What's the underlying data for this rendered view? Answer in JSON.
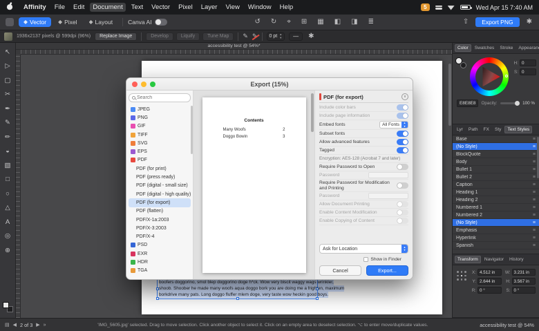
{
  "icons": {
    "arrow_up": "▲",
    "arrow_down": "▼",
    "menu_handle": "≡",
    "chevron_down": "∨",
    "prev": "◀",
    "next": "▶",
    "last": "»",
    "pages": "▤",
    "line": "—",
    "gear": "✱",
    "share": "⇧",
    "paint": "✎"
  },
  "menubar": {
    "items": [
      {
        "label": "Affinity",
        "cls": "b"
      },
      {
        "label": "File"
      },
      {
        "label": "Edit"
      },
      {
        "label": "Document",
        "cls": "hl"
      },
      {
        "label": "Text"
      },
      {
        "label": "Vector"
      },
      {
        "label": "Pixel"
      },
      {
        "label": "Layer"
      },
      {
        "label": "View"
      },
      {
        "label": "Window"
      },
      {
        "label": "Help"
      }
    ],
    "status": {
      "badge": "5",
      "time": "Wed Apr 15 7:40 AM"
    }
  },
  "toolbar": {
    "personas": [
      {
        "label": "Vector",
        "cls": "sel"
      },
      {
        "label": "Pixel"
      },
      {
        "label": "Layout"
      }
    ],
    "canva_label": "Canva AI",
    "center_icons": [
      {
        "name": "undo-icon",
        "glyph": "↺"
      },
      {
        "name": "redo-icon",
        "glyph": "↻"
      },
      {
        "name": "snapping-icon",
        "glyph": "⌖"
      },
      {
        "name": "grid-icon",
        "glyph": "⊞"
      },
      {
        "name": "guides-icon",
        "glyph": "▦"
      },
      {
        "name": "insert-inside-icon",
        "glyph": "◧"
      },
      {
        "name": "insert-behind-icon",
        "glyph": "◨"
      },
      {
        "name": "order-icon",
        "glyph": "≣"
      }
    ],
    "export_button": "Export PNG"
  },
  "context_bar": {
    "image_info": "1936x2137 pixels @ 599dpi (96%)",
    "replace_label": "Replace Image",
    "buttons": [
      {
        "label": "Develop"
      },
      {
        "label": "Liquify"
      },
      {
        "label": "Tune Map"
      }
    ],
    "stroke_width": "0 pt"
  },
  "tools": [
    {
      "name": "move-tool-icon",
      "glyph": "↖"
    },
    {
      "name": "node-tool-icon",
      "glyph": "▷"
    },
    {
      "name": "frame-tool-icon",
      "glyph": "▢"
    },
    {
      "name": "crop-tool-icon",
      "glyph": "✂"
    },
    {
      "name": "pen-tool-icon",
      "glyph": "✒"
    },
    {
      "name": "pencil-tool-icon",
      "glyph": "✎"
    },
    {
      "name": "brush-tool-icon",
      "glyph": "✏"
    },
    {
      "name": "fill-tool-icon",
      "glyph": "◒"
    },
    {
      "name": "transparency-tool-icon",
      "glyph": "▧"
    },
    {
      "name": "rectangle-tool-icon",
      "glyph": "□"
    },
    {
      "name": "ellipse-tool-icon",
      "glyph": "○"
    },
    {
      "name": "shape-tool-icon",
      "glyph": "△"
    },
    {
      "name": "text-tool-icon",
      "glyph": "A"
    },
    {
      "name": "color-picker-tool-icon",
      "glyph": "◎"
    },
    {
      "name": "zoom-tool-icon",
      "glyph": "⊕"
    }
  ],
  "canvas": {
    "doc_tab": "accessibility test @ 54%*",
    "text_lines": [
      "boofers doggorino, smol blep doggorino doge h*ck. Wow very biscit waggy wags wrinkler,",
      "shoob. Shoober he made many woofs aqua doggo bork you are doing me a frighten, maximum",
      "borkdrive many pats. Long doggo fluffer mlem doge, very taste wow heckin good boys."
    ]
  },
  "export_dialog": {
    "title": "Export (15%)",
    "search_placeholder": "Search",
    "formats": [
      {
        "label": "JPEG",
        "color": "#4b8bf5"
      },
      {
        "label": "PNG",
        "color": "#5a67e8"
      },
      {
        "label": "GIF",
        "color": "#e94fb0"
      },
      {
        "label": "TIFF",
        "color": "#f0a33a"
      },
      {
        "label": "SVG",
        "color": "#ef7d3a"
      },
      {
        "label": "EPS",
        "color": "#9b59d0"
      },
      {
        "label": "PDF",
        "color": "#e8493f"
      },
      {
        "label": "PDF (for print)",
        "cls": "preset"
      },
      {
        "label": "PDF (press ready)",
        "cls": "preset"
      },
      {
        "label": "PDF (digital - small size)",
        "cls": "preset"
      },
      {
        "label": "PDF (digital - high quality)",
        "cls": "preset"
      },
      {
        "label": "PDF (for export)",
        "cls": "preset sel"
      },
      {
        "label": "PDF (flatten)",
        "cls": "preset"
      },
      {
        "label": "PDF/X-1a:2003",
        "cls": "preset"
      },
      {
        "label": "PDF/X-3:2003",
        "cls": "preset"
      },
      {
        "label": "PDF/X-4",
        "cls": "preset"
      },
      {
        "label": "PSD",
        "color": "#3566d6"
      },
      {
        "label": "EXR",
        "color": "#d8345f"
      },
      {
        "label": "HDR",
        "color": "#39b54a"
      },
      {
        "label": "TGA",
        "color": "#e89a3a"
      }
    ],
    "preview": {
      "heading": "Contents",
      "entries": [
        {
          "label": "Many Woofs",
          "page": "2"
        },
        {
          "label": "Doggo Bowin",
          "page": "3"
        }
      ]
    },
    "settings": {
      "header": "PDF (for export)",
      "rows": [
        {
          "label": "Include color bars",
          "rcls": "toggle",
          "state": "dim-on",
          "lcls": "muted"
        },
        {
          "label": "Include page information",
          "rcls": "toggle",
          "state": "dim-on",
          "lcls": "muted"
        },
        {
          "label": "Embed fonts",
          "rcls": "select",
          "value": "All Fonts"
        },
        {
          "label": "Subset fonts",
          "rcls": "toggle",
          "state": "on"
        },
        {
          "label": "Allow advanced features",
          "rcls": "toggle",
          "state": "on"
        },
        {
          "label": "Tagged",
          "rcls": "toggle",
          "state": "on"
        },
        {
          "label": "Encryption: AES-128 (Acrobat 7 and later)",
          "rcls": "info"
        },
        {
          "label": "Require Password to Open",
          "rcls": "toggle",
          "state": "off"
        },
        {
          "label": "Password",
          "rcls": "field",
          "lcls": "muted"
        },
        {
          "label": "Require Password for Modification and Printing",
          "rcls": "toggle two",
          "state": "off"
        },
        {
          "label": "Password",
          "rcls": "field",
          "lcls": "muted"
        },
        {
          "label": "Allow Document Printing",
          "rcls": "toggle",
          "state": "dim-off",
          "lcls": "muted"
        },
        {
          "label": "Enable Content Modification",
          "rcls": "toggle",
          "state": "dim-off",
          "lcls": "muted"
        },
        {
          "label": "Enable Copying of Content",
          "rcls": "toggle",
          "state": "dim-off",
          "lcls": "muted"
        }
      ],
      "location_value": "Ask for Location",
      "show_in_finder": "Show in Finder",
      "cancel_label": "Cancel",
      "export_label": "Export..."
    }
  },
  "panels": {
    "color": {
      "tabs": [
        {
          "label": "Color",
          "cls": "sel"
        },
        {
          "label": "Swatches"
        },
        {
          "label": "Stroke"
        },
        {
          "label": "Appearance"
        }
      ],
      "h_label": "H:",
      "h_value": "0",
      "s_label": "S:",
      "s_value": "0",
      "opacity_label": "Opacity:",
      "opacity_value": "100 %",
      "hex_value": "E8E8E8"
    },
    "styles": {
      "tabs": [
        {
          "label": "Lyr"
        },
        {
          "label": "Path"
        },
        {
          "label": "FX"
        },
        {
          "label": "Sty"
        },
        {
          "label": "Text Styles",
          "cls": "sel"
        }
      ],
      "items": [
        {
          "label": "Base"
        },
        {
          "label": "(No Style)",
          "cls": "sel"
        },
        {
          "label": "BlockQuote"
        },
        {
          "label": "Body"
        },
        {
          "label": "Bullet 1"
        },
        {
          "label": "Bullet 2"
        },
        {
          "label": "Caption"
        },
        {
          "label": "Heading 1"
        },
        {
          "label": "Heading 2"
        },
        {
          "label": "Numbered 1"
        },
        {
          "label": "Numbered 2"
        },
        {
          "label": "(No Style)",
          "cls": "sel"
        },
        {
          "label": "Emphasis"
        },
        {
          "label": "Hyperlink"
        },
        {
          "label": "Spanish"
        }
      ]
    },
    "transform": {
      "tabs": [
        {
          "label": "Transform",
          "cls": "sel"
        },
        {
          "label": "Navigator"
        },
        {
          "label": "History"
        }
      ],
      "fields": [
        {
          "k": "X:",
          "v": "4.512 in"
        },
        {
          "k": "W:",
          "v": "3.231 in"
        },
        {
          "k": "Y:",
          "v": "2.644 in"
        },
        {
          "k": "H:",
          "v": "3.567 in"
        },
        {
          "k": "R:",
          "v": "0 °"
        },
        {
          "k": "S:",
          "v": "0 °"
        }
      ]
    }
  },
  "statusbar": {
    "page_label": "2 of 3",
    "hint": "'IMG_5605.jpg' selected. Drag to move selection. Click another object to select it. Click on an empty area to deselect selection. ⌥ to enter move/duplicate values.",
    "zoom_label": "accessibility test @ 54%"
  }
}
